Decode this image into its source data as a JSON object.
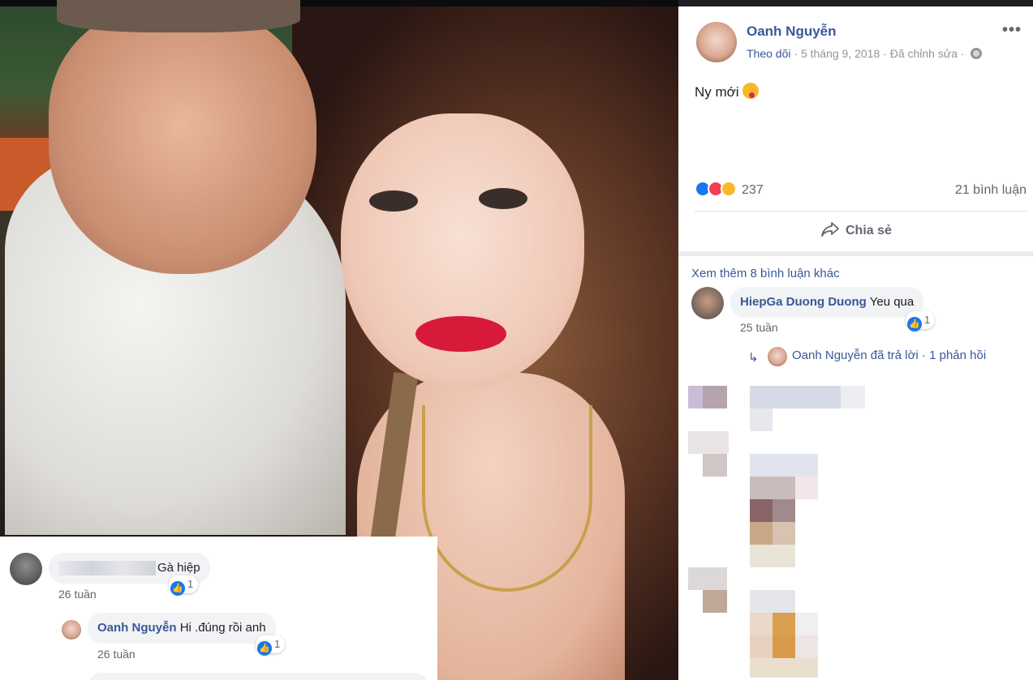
{
  "post": {
    "author": "Oanh Nguyễn",
    "follow": "Theo dõi",
    "date": "5 tháng 9, 2018",
    "edited": "Đã chỉnh sửa",
    "separator": "·",
    "more": "•••",
    "text": "Ny mới",
    "reactions_count": "237",
    "comments_count": "21 bình luận",
    "share_label": "Chia sẻ"
  },
  "comments": {
    "view_more": "Xem thêm 8 bình luận khác",
    "items": [
      {
        "name": "HiepGa Duong Duong",
        "text": "Yeu qua",
        "time": "25 tuần",
        "likes": "1",
        "reply_summary": "Oanh Nguyễn đã trả lời · 1 phản hồi"
      }
    ]
  },
  "overlay_comments": [
    {
      "text": "Gà hiệp",
      "time": "26 tuần",
      "likes": "1"
    },
    {
      "name": "Oanh Nguyễn",
      "text": "Hi .đúng rồi anh",
      "time": "26 tuần",
      "likes": "1"
    }
  ],
  "colors": {
    "link": "#385898",
    "like": "#1877f2",
    "love": "#f33e58",
    "haha": "#f7b928",
    "bubble": "#f2f3f5"
  },
  "icons": [
    "more-icon",
    "globe-icon",
    "like-icon",
    "love-icon",
    "haha-icon",
    "share-icon",
    "reply-arrow-icon",
    "tongue-emoji-icon"
  ]
}
